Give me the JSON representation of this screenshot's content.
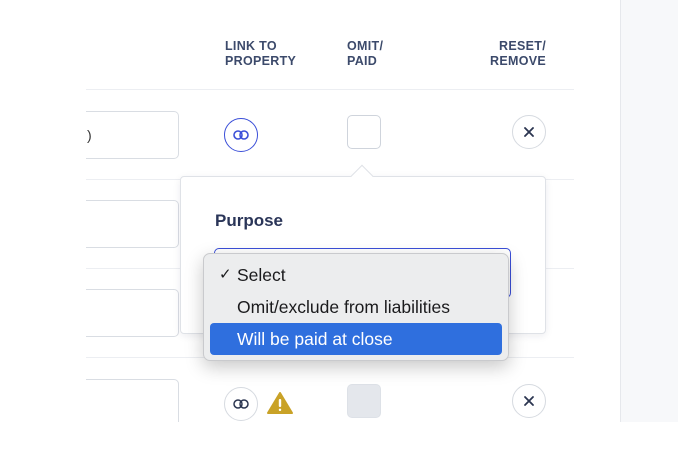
{
  "columns": {
    "link": [
      "LINK TO",
      "PROPERTY"
    ],
    "omit": [
      "OMIT/",
      "PAID"
    ],
    "reset": [
      "RESET/",
      "REMOVE"
    ]
  },
  "rows": [
    {
      "field_fragment": ")",
      "linked": true,
      "omit_checked": false,
      "has_warning": false
    }
  ],
  "popover": {
    "label": "Purpose"
  },
  "dropdown": {
    "options": [
      {
        "label": "Select",
        "selected": true,
        "highlighted": false
      },
      {
        "label": "Omit/exclude from liabilities",
        "selected": false,
        "highlighted": false
      },
      {
        "label": "Will be paid at close",
        "selected": false,
        "highlighted": true
      }
    ],
    "check_mark": "✓"
  },
  "icons": {
    "link": "link-icon",
    "close": "close-icon",
    "warning": "warning-icon"
  },
  "colors": {
    "accent": "#3b4fd8",
    "highlight": "#2f6fde",
    "warning": "#c9a227",
    "header_text": "#3c4a6b"
  }
}
